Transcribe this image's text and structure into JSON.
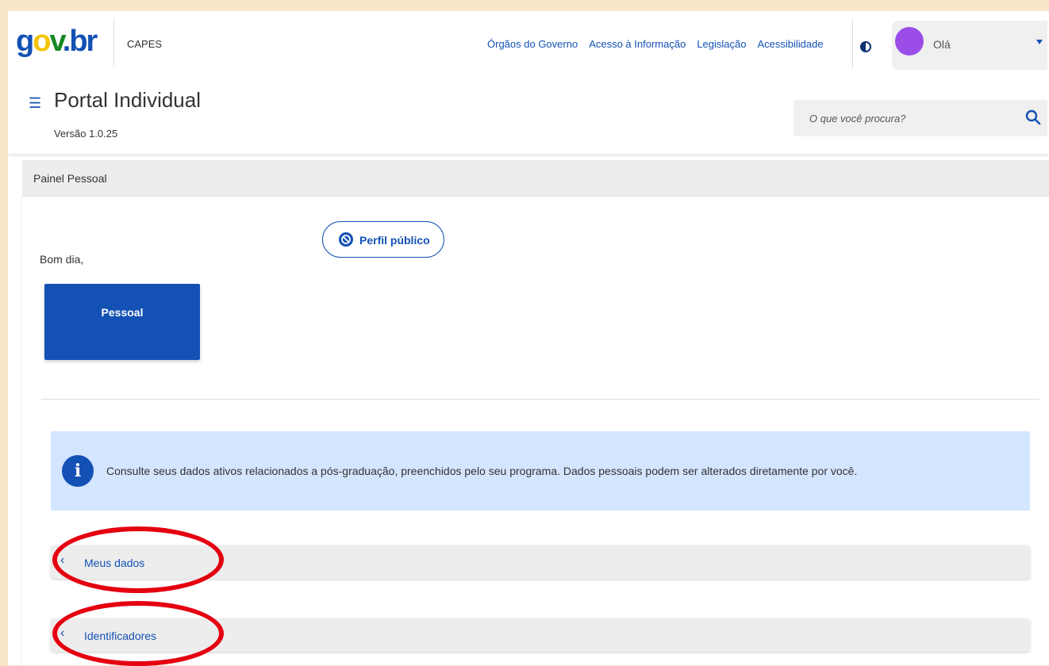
{
  "header": {
    "logo_text": "gov.br",
    "org": "CAPES",
    "links": [
      "Órgãos do Governo",
      "Acesso à Informação",
      "Legislação",
      "Acessibilidade"
    ],
    "contrast_icon": "contrast-icon",
    "user": {
      "greeting": "Olá",
      "avatar_color": "#9b4de8"
    },
    "app_title": "Portal Individual",
    "version": "Versão 1.0.25",
    "search": {
      "placeholder": "O que você procura?",
      "icon": "search-icon"
    }
  },
  "breadcrumb": {
    "label": "Painel Pessoal"
  },
  "main": {
    "greeting": "Bom dia,",
    "public_profile_button": "Perfil público",
    "card_label": "Pessoal",
    "alert": {
      "icon": "info-icon",
      "text": "Consulte seus dados ativos relacionados a pós-graduação, preenchidos pelo seu programa. Dados pessoais podem ser alterados diretamente por você."
    },
    "accordions": [
      {
        "label": "Meus dados"
      },
      {
        "label": "Identificadores"
      }
    ]
  },
  "colors": {
    "primary": "#1351b4",
    "alert_bg": "#d4e5ff",
    "annotation": "#e40010",
    "page_bg": "#f8e6c9"
  }
}
